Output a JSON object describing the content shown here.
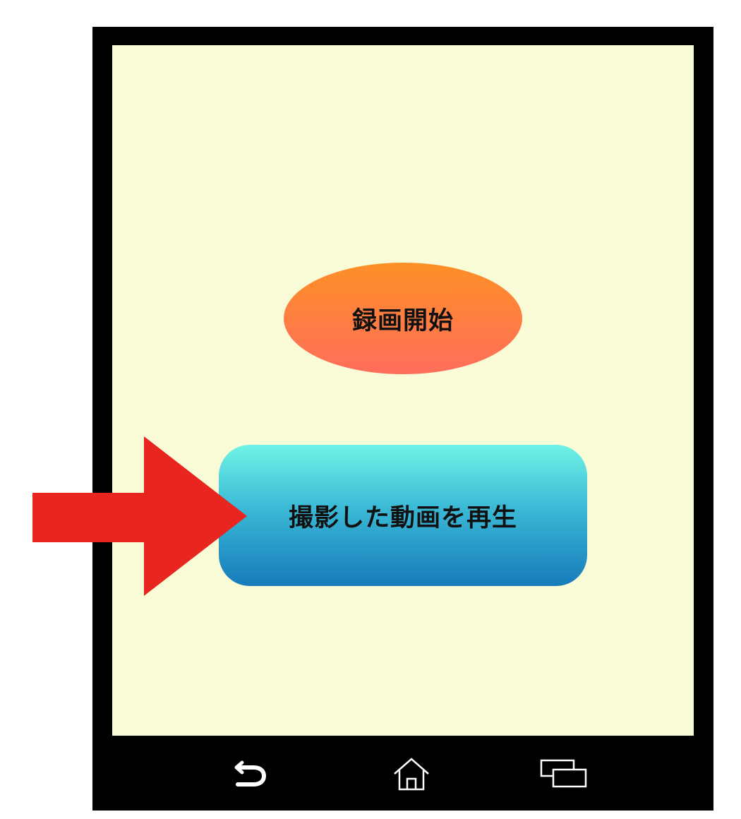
{
  "main": {
    "record_button_label": "録画開始",
    "play_button_label": "撮影した動画を再生"
  },
  "navbar": {
    "back_icon": "back-icon",
    "home_icon": "home-icon",
    "recent_icon": "recent-apps-icon"
  },
  "annotation": {
    "arrow_color": "#e8261f"
  },
  "colors": {
    "screen_bg": "#fafcd7",
    "device_frame": "#000000",
    "record_gradient_top": "#fd9026",
    "record_gradient_bottom": "#ff6d5c",
    "play_gradient_top": "#6ff3e6",
    "play_gradient_bottom": "#167bba"
  }
}
